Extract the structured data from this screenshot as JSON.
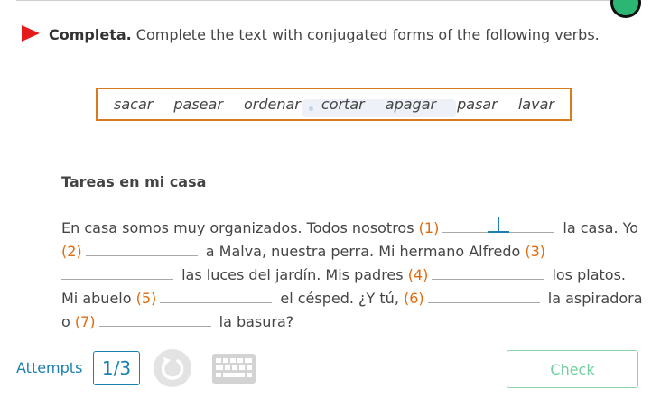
{
  "instruction": {
    "bold": "Completa.",
    "text": " Complete the text with conjugated forms of the following verbs."
  },
  "word_bank": [
    "sacar",
    "pasear",
    "ordenar",
    "cortar",
    "apagar",
    "pasar",
    "lavar"
  ],
  "exercise": {
    "title": "Tareas en mi casa",
    "lines": [
      {
        "before": "En casa somos muy organizados. Todos nosotros ",
        "num": "(1)",
        "after": " la casa. Yo"
      },
      {
        "before": "",
        "num": "(2)",
        "after": " a Malva, nuestra perra. Mi hermano Alfredo ",
        "num2": "(3)"
      },
      {
        "before": "",
        "num": "",
        "after": " las luces del jardín. Mis padres ",
        "num2": "(4)",
        "after2": " los platos."
      },
      {
        "before": "Mi abuelo ",
        "num": "(5)",
        "after": " el césped. ¿Y tú, ",
        "num2": "(6)",
        "after2": " la aspiradora"
      },
      {
        "before": "o ",
        "num": "(7)",
        "after": " la basura?"
      }
    ]
  },
  "footer": {
    "attempts_label": "Attempts",
    "attempts_value": "1/3",
    "check_label": "Check"
  },
  "colors": {
    "accent": "#1a7fae",
    "number": "#e06a0e",
    "flag": "#e51b1b",
    "wordbox_border": "#d87a1e",
    "check": "#6fcf9e"
  },
  "icons": [
    "flag-icon",
    "reset-icon",
    "keyboard-icon"
  ]
}
